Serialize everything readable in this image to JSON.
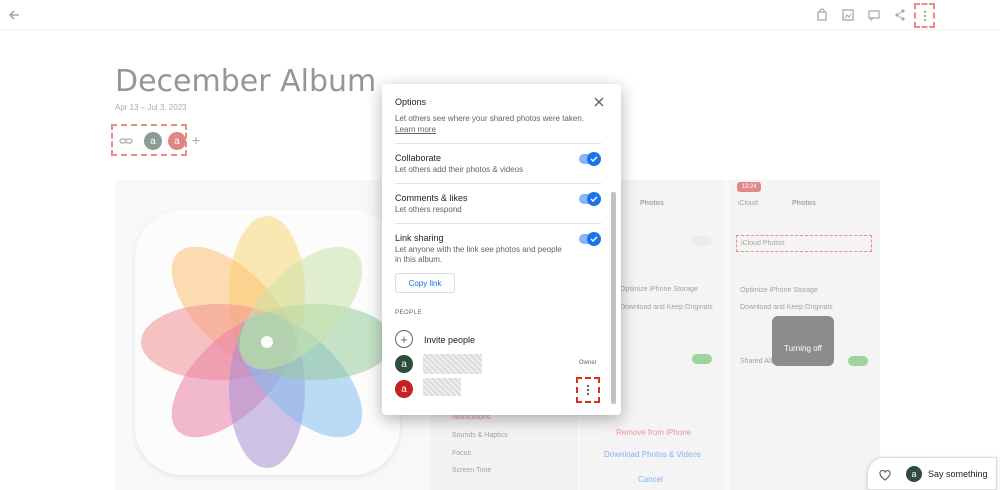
{
  "album": {
    "title": "December Album",
    "dates": "Apr 13 – Jul 3, 2023",
    "avatar_letter": "a"
  },
  "dialog": {
    "title": "Options",
    "location_text": "Let others see where your shared photos were taken.",
    "learn_more": "Learn more",
    "options": [
      {
        "title": "Collaborate",
        "desc": "Let others add their photos & videos"
      },
      {
        "title": "Comments & likes",
        "desc": "Let others respond"
      },
      {
        "title": "Link sharing",
        "desc": "Let anyone with the link see photos and people in this album."
      }
    ],
    "copy_link": "Copy link",
    "people_heading": "PEOPLE",
    "invite_label": "Invite people",
    "owner_label": "Owner",
    "person_letter": "a"
  },
  "background_phones": {
    "photos_title": "Photos",
    "icloud_back": "iCloud",
    "icloud_photos": "iCloud Photos",
    "optimize": "Optimize iPhone Storage",
    "download_keep": "Download and Keep Originals",
    "shared_albums": "Shared Albums",
    "turning_off": "Turning off",
    "time_badge": "13:24",
    "remove_from_iphone": "Remove from iPhone",
    "download_photos_videos": "Download Photos & Videos",
    "cancel": "Cancel",
    "settings_items": [
      "Notifications",
      "Sounds & Haptics",
      "Focus",
      "Screen Time"
    ]
  },
  "chat": {
    "say_something": "Say something",
    "avatar_letter": "a"
  },
  "colors": {
    "accent": "#1a73e8",
    "highlight": "#d93025",
    "avatar_green": "#2e4b3c",
    "avatar_red": "#c5221f"
  }
}
